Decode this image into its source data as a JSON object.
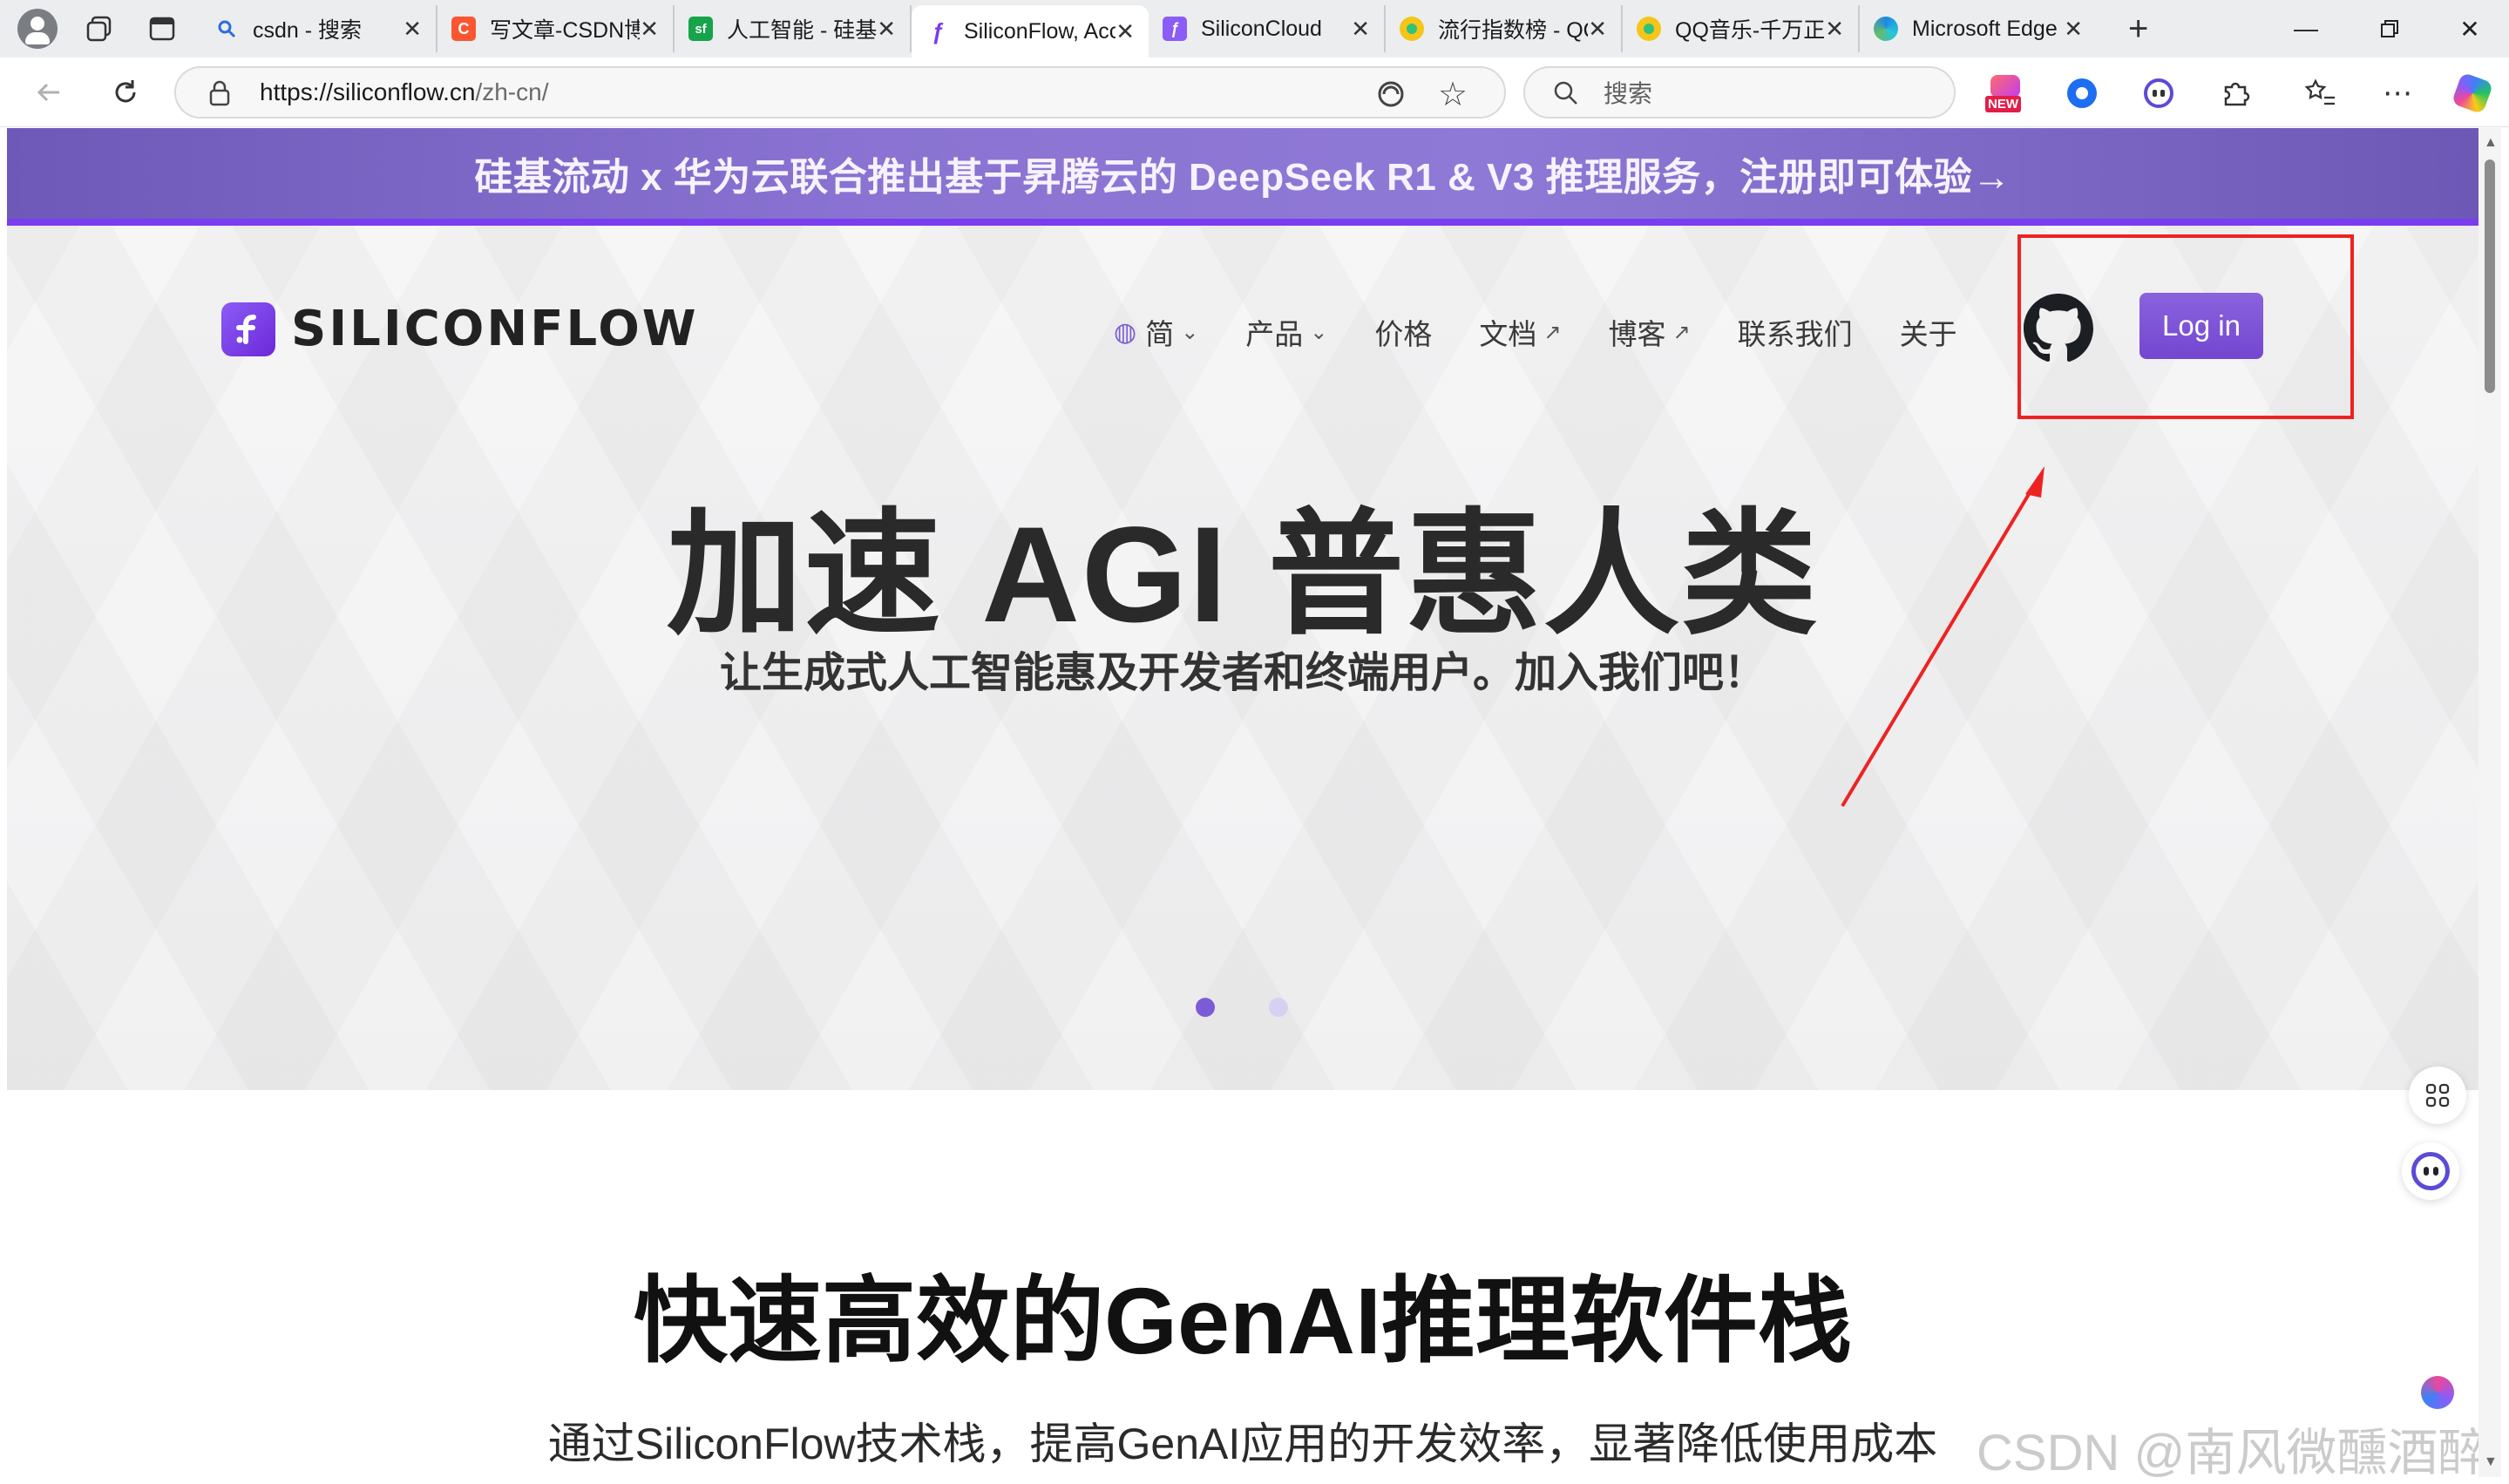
{
  "browser": {
    "tabs": [
      {
        "title": "csdn - 搜索",
        "icon": "search-icon",
        "color": "#2b6de0"
      },
      {
        "title": "写文章-CSDN博客",
        "icon": "csdn-icon",
        "color": "#fc5531"
      },
      {
        "title": "人工智能 - 硅基流动",
        "icon": "sf-icon",
        "color": "#16a34a"
      },
      {
        "title": "SiliconFlow, Accelerate",
        "icon": "siliconflow-icon",
        "color": "#7c3aed",
        "active": true
      },
      {
        "title": "SiliconCloud",
        "icon": "siliconcloud-icon",
        "color": "#8b5cf6"
      },
      {
        "title": "流行指数榜 - QQ音乐",
        "icon": "qqmusic-icon",
        "color": "#31c27c"
      },
      {
        "title": "QQ音乐-千万正版音乐",
        "icon": "qqmusic-icon",
        "color": "#31c27c"
      },
      {
        "title": "Microsoft Edge",
        "icon": "edge-icon",
        "color": "#1e88e5"
      }
    ],
    "url_host": "https://siliconflow.cn",
    "url_path": "/zh-cn/",
    "search_placeholder": "搜索",
    "new_badge": "NEW"
  },
  "banner": {
    "text": "硅基流动 x 华为云联合推出基于昇腾云的 DeepSeek R1 & V3 推理服务，注册即可体验→"
  },
  "header": {
    "logo_text": "SILICONFLOW",
    "nav": [
      {
        "label": "简",
        "suffix": "⌄",
        "globe": true
      },
      {
        "label": "产品",
        "suffix": "⌄"
      },
      {
        "label": "价格",
        "suffix": ""
      },
      {
        "label": "文档",
        "suffix": "↗"
      },
      {
        "label": "博客",
        "suffix": "↗"
      },
      {
        "label": "联系我们",
        "suffix": ""
      },
      {
        "label": "关于",
        "suffix": ""
      }
    ],
    "login_label": "Log in"
  },
  "hero": {
    "title": "加速 AGI 普惠人类",
    "subtitle": "让生成式人工智能惠及开发者和终端用户。加入我们吧！",
    "carousel_active_color": "#7c5cd6",
    "carousel_inactive_color": "#d8d0f3"
  },
  "section": {
    "title": "快速高效的GenAI推理软件栈",
    "description": "通过SiliconFlow技术栈，提高GenAI应用的开发效率，显著降低使用成本"
  },
  "watermark": "CSDN @南风微醺酒醉人",
  "colors": {
    "brand": "#7c3aed",
    "annotation_red": "#ee2222"
  }
}
